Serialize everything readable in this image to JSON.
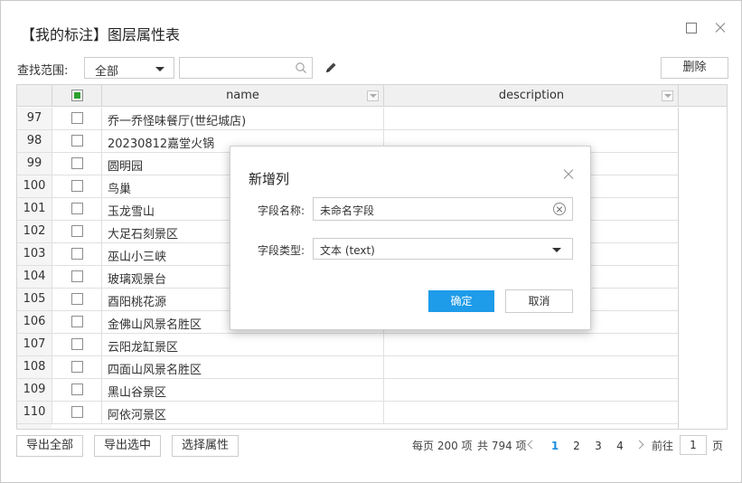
{
  "window": {
    "title": "【我的标注】图层属性表"
  },
  "toolbar": {
    "scope_label": "查找范围:",
    "scope_value": "全部",
    "search_value": "",
    "delete_label": "删除"
  },
  "table": {
    "columns": [
      "name",
      "description"
    ],
    "rows": [
      {
        "num": "97",
        "name": "乔一乔怪味餐厅(世纪城店)",
        "description": ""
      },
      {
        "num": "98",
        "name": "20230812嘉堂火锅",
        "description": ""
      },
      {
        "num": "99",
        "name": "圆明园",
        "description": ""
      },
      {
        "num": "100",
        "name": "鸟巢",
        "description": ""
      },
      {
        "num": "101",
        "name": "玉龙雪山",
        "description": ""
      },
      {
        "num": "102",
        "name": "大足石刻景区",
        "description": ""
      },
      {
        "num": "103",
        "name": "巫山小三峡",
        "description": ""
      },
      {
        "num": "104",
        "name": "玻璃观景台",
        "description": ""
      },
      {
        "num": "105",
        "name": "酉阳桃花源",
        "description": ""
      },
      {
        "num": "106",
        "name": "金佛山风景名胜区",
        "description": ""
      },
      {
        "num": "107",
        "name": "云阳龙缸景区",
        "description": ""
      },
      {
        "num": "108",
        "name": "四面山风景名胜区",
        "description": ""
      },
      {
        "num": "109",
        "name": "黑山谷景区",
        "description": ""
      },
      {
        "num": "110",
        "name": "阿依河景区",
        "description": ""
      }
    ]
  },
  "footer": {
    "export_all": "导出全部",
    "export_selected": "导出选中",
    "select_attributes": "选择属性",
    "per_page": "每页 200 项",
    "total": "共 794 项",
    "pages": [
      "1",
      "2",
      "3",
      "4"
    ],
    "current_page": "1",
    "goto_label": "前往",
    "goto_value": "1",
    "page_unit": "页"
  },
  "dialog": {
    "title": "新增列",
    "field_name_label": "字段名称:",
    "field_name_value": "未命名字段",
    "field_type_label": "字段类型:",
    "field_type_value": "文本 (text)",
    "ok_label": "确定",
    "cancel_label": "取消"
  },
  "colors": {
    "accent": "#1e9be9",
    "checkbox_partial": "#2ea12e"
  }
}
